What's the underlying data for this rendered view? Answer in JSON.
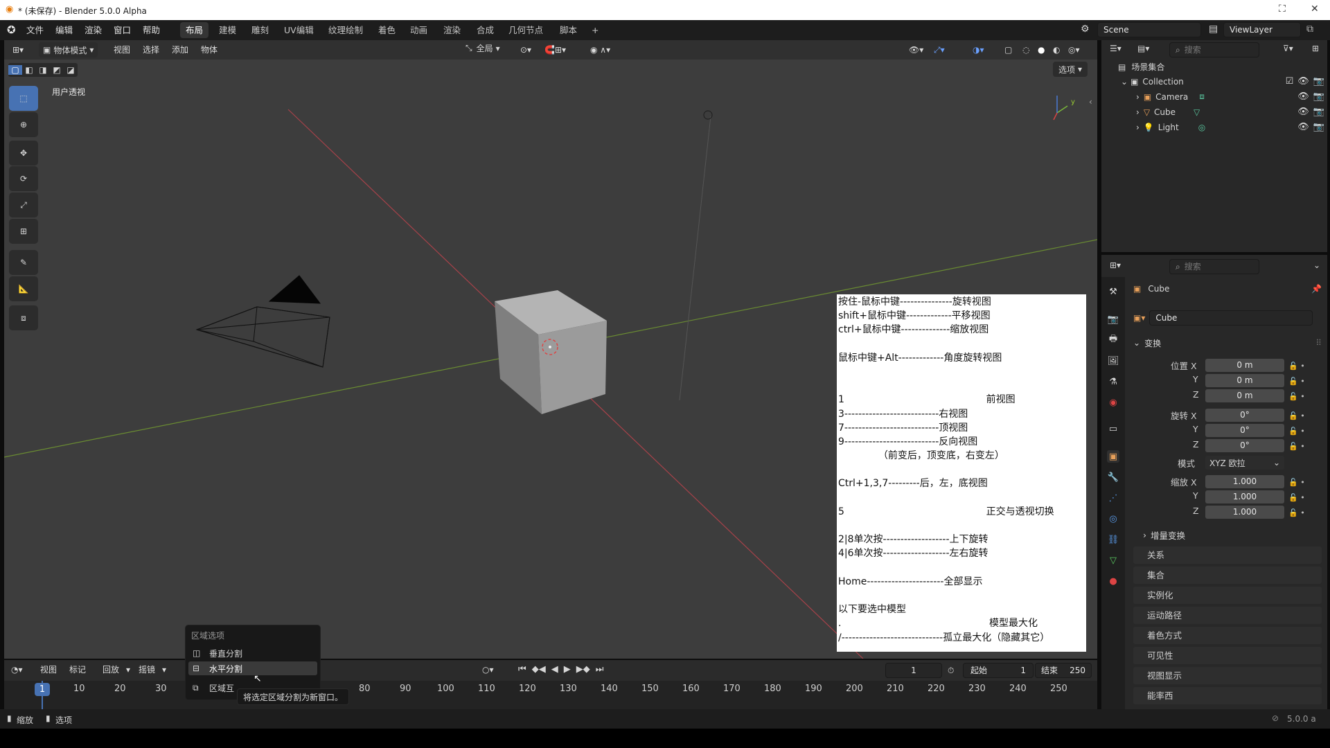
{
  "window": {
    "title": "* (未保存) - Blender 5.0.0 Alpha",
    "controls": [
      "⛶",
      "✕"
    ]
  },
  "topmenu": {
    "items": [
      "文件",
      "编辑",
      "渲染",
      "窗口",
      "帮助"
    ],
    "workspaces": [
      "布局",
      "建模",
      "雕刻",
      "UV编辑",
      "纹理绘制",
      "着色",
      "动画",
      "渲染",
      "合成",
      "几何节点",
      "脚本"
    ],
    "active_workspace": "布局",
    "add_tab": "+",
    "scene": "Scene",
    "view_layer": "ViewLayer"
  },
  "viewport": {
    "mode": "物体模式",
    "menus": [
      "视图",
      "选择",
      "添加",
      "物体"
    ],
    "transform_orientation": "全局",
    "view_label": "用户透视",
    "options_label": "选项"
  },
  "notes": {
    "lines": [
      "按住-鼠标中键---------------旋转视图",
      "shift+鼠标中键-------------平移视图",
      "ctrl+鼠标中键--------------缩放视图",
      "",
      "鼠标中键+Alt-------------角度旋转视图",
      "",
      "",
      "1                                              前视图",
      "3---------------------------右视图",
      "7---------------------------顶视图",
      "9---------------------------反向视图",
      "             （前变后，顶变底，右变左）",
      "",
      "Ctrl+1,3,7---------后，左，底视图",
      "",
      "5                                              正交与透视切换",
      "",
      "2|8单次按-------------------上下旋转",
      "4|6单次按-------------------左右旋转",
      "",
      "Home----------------------全部显示",
      "",
      "以下要选中模型",
      ".                                                模型最大化",
      "/-----------------------------孤立最大化（隐藏其它）"
    ]
  },
  "timeline": {
    "menus": [
      "视图",
      "标记",
      "回放",
      "摇镜"
    ],
    "current_frame": "1",
    "start_label": "起始",
    "start_value": "1",
    "end_label": "结束",
    "end_value": "250",
    "ticks": [
      "1",
      "10",
      "20",
      "30",
      "80",
      "90",
      "100",
      "110",
      "120",
      "130",
      "140",
      "150",
      "160",
      "170",
      "180",
      "190",
      "200",
      "210",
      "220",
      "230",
      "240",
      "250"
    ]
  },
  "popup": {
    "title": "区域选项",
    "items": [
      "垂直分割",
      "水平分割",
      "区域互"
    ],
    "tooltip": "将选定区域分割为新窗口。"
  },
  "status": {
    "left1": "缩放",
    "left2": "选项",
    "version": "5.0.0 a"
  },
  "outliner": {
    "search_placeholder": "搜索",
    "root": "场景集合",
    "collection": "Collection",
    "objects": [
      "Camera",
      "Cube",
      "Light"
    ]
  },
  "properties": {
    "search_placeholder": "搜索",
    "object_name": "Cube",
    "data_name": "Cube",
    "transform_header": "变换",
    "location_label": "位置 X",
    "rotation_label": "旋转 X",
    "scale_label": "缩放 X",
    "axis_y": "Y",
    "axis_z": "Z",
    "location": [
      "0 m",
      "0 m",
      "0 m"
    ],
    "rotation": [
      "0°",
      "0°",
      "0°"
    ],
    "mode_label": "模式",
    "mode_value": "XYZ 欧拉",
    "scale": [
      "1.000",
      "1.000",
      "1.000"
    ],
    "delta_transform": "增量变换",
    "sections": [
      "关系",
      "集合",
      "实例化",
      "运动路径",
      "着色方式",
      "可见性",
      "视图显示",
      "能率西"
    ]
  }
}
